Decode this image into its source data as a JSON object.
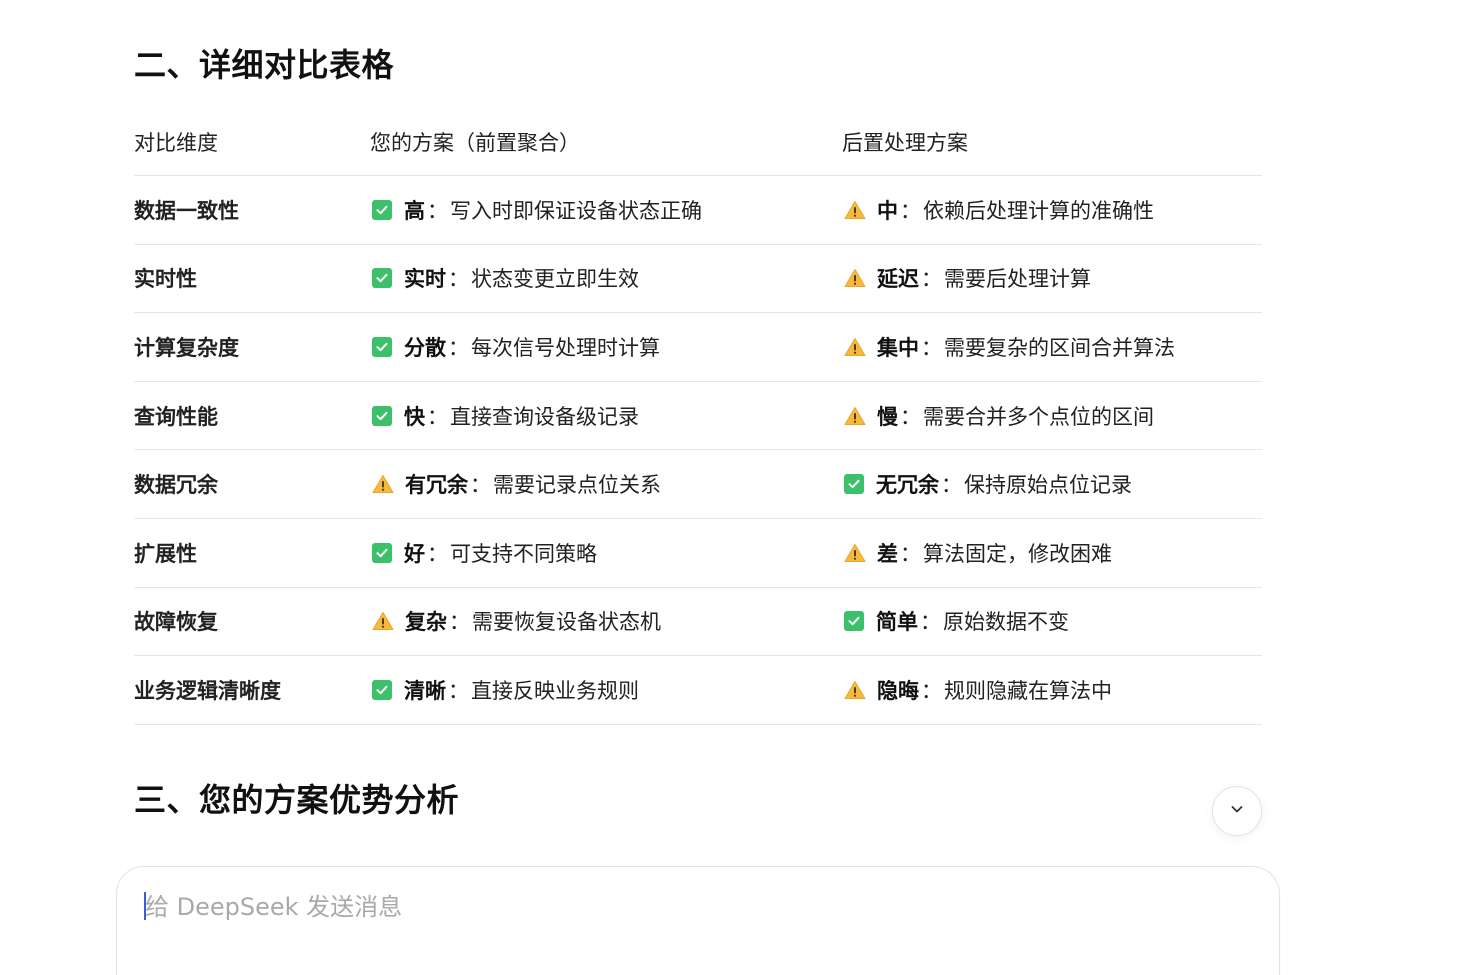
{
  "headings": {
    "section_two": "二、详细对比表格",
    "section_three": "三、您的方案优势分析"
  },
  "table": {
    "headers": [
      "对比维度",
      "您的方案（前置聚合）",
      "后置处理方案"
    ],
    "rows": [
      {
        "dimension": "数据一致性",
        "a": {
          "status": "check",
          "title": "高",
          "desc": "写入时即保证设备状态正确"
        },
        "b": {
          "status": "warning",
          "title": "中",
          "desc": "依赖后处理计算的准确性"
        }
      },
      {
        "dimension": "实时性",
        "a": {
          "status": "check",
          "title": "实时",
          "desc": "状态变更立即生效"
        },
        "b": {
          "status": "warning",
          "title": "延迟",
          "desc": "需要后处理计算"
        }
      },
      {
        "dimension": "计算复杂度",
        "a": {
          "status": "check",
          "title": "分散",
          "desc": "每次信号处理时计算"
        },
        "b": {
          "status": "warning",
          "title": "集中",
          "desc": "需要复杂的区间合并算法"
        }
      },
      {
        "dimension": "查询性能",
        "a": {
          "status": "check",
          "title": "快",
          "desc": "直接查询设备级记录"
        },
        "b": {
          "status": "warning",
          "title": "慢",
          "desc": "需要合并多个点位的区间"
        }
      },
      {
        "dimension": "数据冗余",
        "a": {
          "status": "warning",
          "title": "有冗余",
          "desc": "需要记录点位关系"
        },
        "b": {
          "status": "check",
          "title": "无冗余",
          "desc": "保持原始点位记录"
        }
      },
      {
        "dimension": "扩展性",
        "a": {
          "status": "check",
          "title": "好",
          "desc": "可支持不同策略"
        },
        "b": {
          "status": "warning",
          "title": "差",
          "desc": "算法固定，修改困难"
        }
      },
      {
        "dimension": "故障恢复",
        "a": {
          "status": "warning",
          "title": "复杂",
          "desc": "需要恢复设备状态机"
        },
        "b": {
          "status": "check",
          "title": "简单",
          "desc": "原始数据不变"
        }
      },
      {
        "dimension": "业务逻辑清晰度",
        "a": {
          "status": "check",
          "title": "清晰",
          "desc": "直接反映业务规则"
        },
        "b": {
          "status": "warning",
          "title": "隐晦",
          "desc": "规则隐藏在算法中"
        }
      }
    ],
    "separator": "："
  },
  "composer": {
    "placeholder": "给 DeepSeek 发送消息",
    "value": ""
  },
  "icons": {
    "scroll_down": "chevron-down-icon",
    "check": "check-mark-icon",
    "warning": "warning-icon"
  },
  "colors": {
    "check_green": "#3cc06a",
    "warning_yellow": "#f6b93b",
    "caret_blue": "#3b5bdb"
  }
}
